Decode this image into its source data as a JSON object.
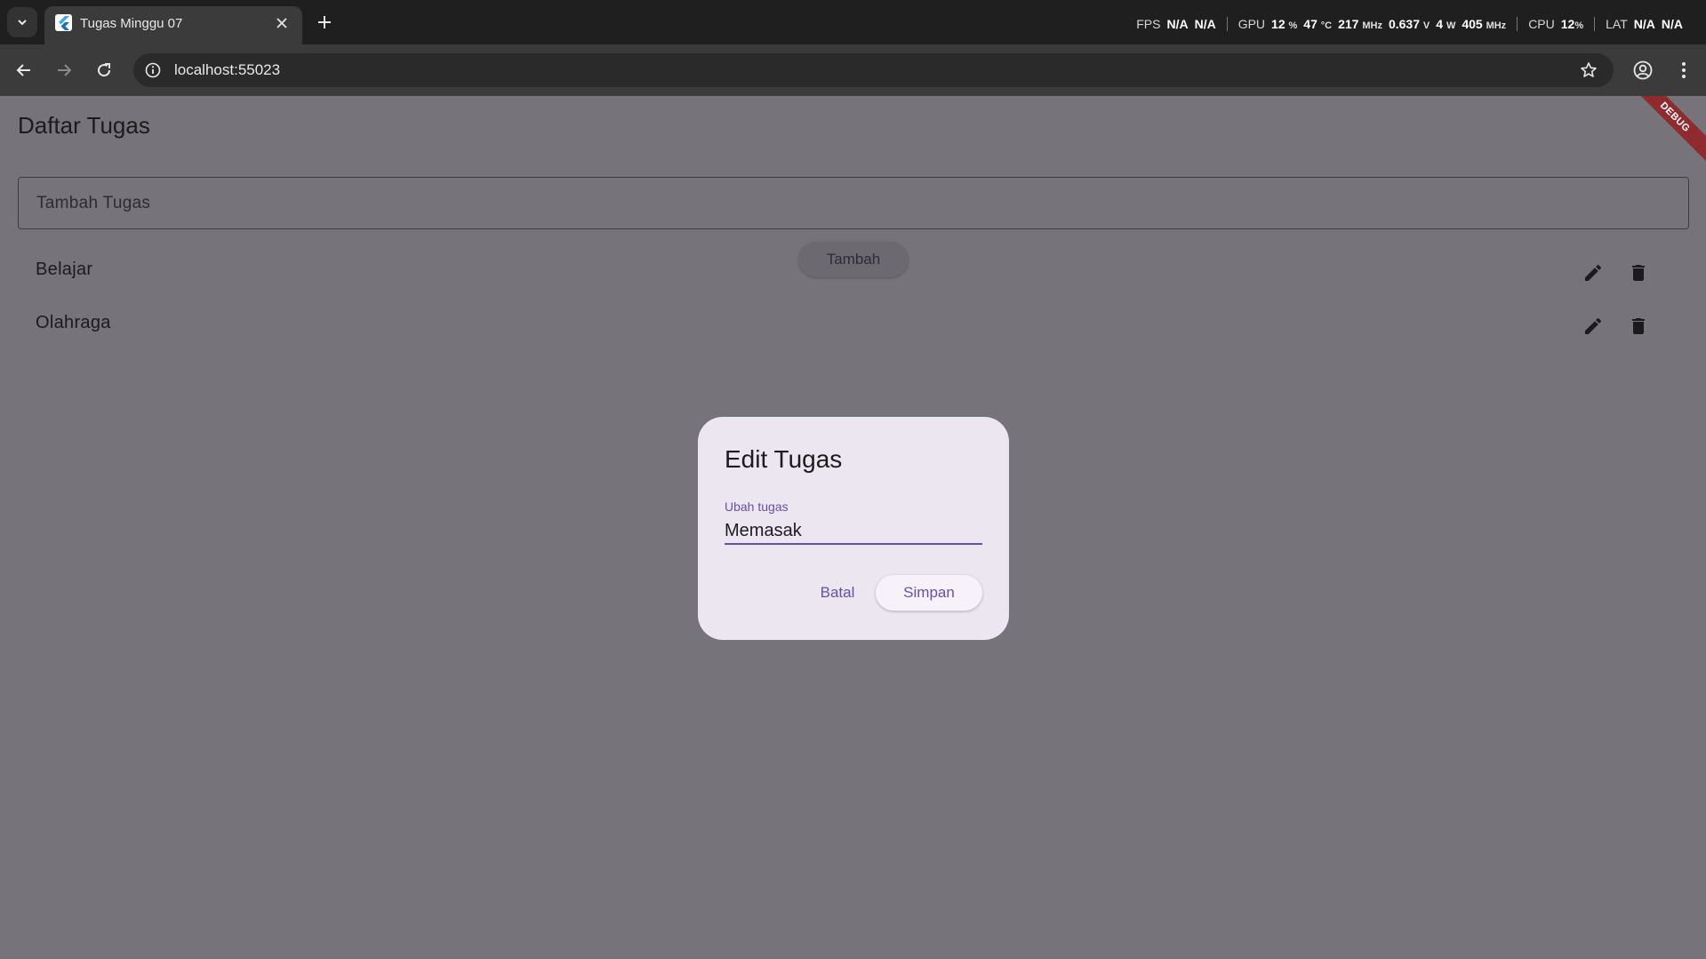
{
  "browser": {
    "tab_title": "Tugas Minggu 07",
    "url": "localhost:55023",
    "stats": {
      "fps_label": "FPS",
      "fps_val1": "N/A",
      "fps_val2": "N/A",
      "gpu_label": "GPU",
      "gpu_pct": "12",
      "gpu_pct_unit": "%",
      "gpu_temp": "47",
      "gpu_temp_unit": "°C",
      "gpu_mhz": "217",
      "gpu_mhz_unit": "MHz",
      "gpu_volt": "0.637",
      "gpu_volt_unit": "V",
      "gpu_watt": "4",
      "gpu_watt_unit": "W",
      "gpu_mem_mhz": "405",
      "gpu_mem_mhz_unit": "MHz",
      "cpu_label": "CPU",
      "cpu_pct": "12",
      "cpu_pct_unit": "%",
      "lat_label": "LAT",
      "lat_val1": "N/A",
      "lat_val2": "N/A"
    }
  },
  "app": {
    "debug_banner": "DEBUG",
    "title": "Daftar Tugas",
    "add_placeholder": "Tambah Tugas",
    "add_button": "Tambah",
    "tasks": [
      {
        "label": "Belajar"
      },
      {
        "label": "Olahraga"
      }
    ]
  },
  "dialog": {
    "title": "Edit Tugas",
    "field_label": "Ubah tugas",
    "field_value": "Memasak",
    "cancel_label": "Batal",
    "save_label": "Simpan"
  },
  "colors": {
    "scrim": "#77737a",
    "dialog_bg": "#ece6f0",
    "primary": "#6750a4",
    "debug_banner": "#8f2a2f"
  },
  "icons": {
    "tab_search": "chevron-down-icon",
    "close": "close-icon",
    "new_tab": "plus-icon",
    "back": "arrow-left-icon",
    "forward": "arrow-right-icon",
    "reload": "reload-icon",
    "site_info": "info-icon",
    "bookmark": "star-icon",
    "profile": "profile-icon",
    "menu": "more-vertical-icon",
    "edit": "pencil-icon",
    "delete": "trash-icon"
  }
}
